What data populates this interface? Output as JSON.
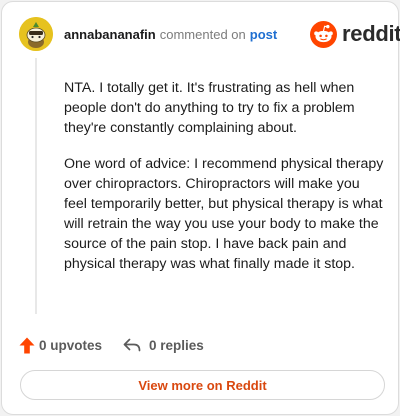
{
  "comment": {
    "username": "annabananafin",
    "verb": "commented on",
    "post_link": "post",
    "paragraphs": [
      "NTA. I totally get it. It's frustrating as hell when people don't do anything to try to fix a problem they're constantly complaining about.",
      "One word of advice: I recommend physical therapy over chiropractors. Chiropractors will make you feel temporarily better, but physical therapy is what will retrain the way you use your body to make the source of the pain stop. I have back pain and physical therapy was what finally made it stop."
    ]
  },
  "brand": {
    "name": "reddit",
    "icon": "reddit-logo-icon",
    "color": "#ff4500"
  },
  "actions": {
    "upvotes_label": "0 upvotes",
    "upvote_icon": "upvote-arrow-icon",
    "replies_label": "0 replies",
    "reply_icon": "reply-arrow-icon"
  },
  "view_more": {
    "label": "View more on Reddit",
    "color": "#d9480f"
  }
}
